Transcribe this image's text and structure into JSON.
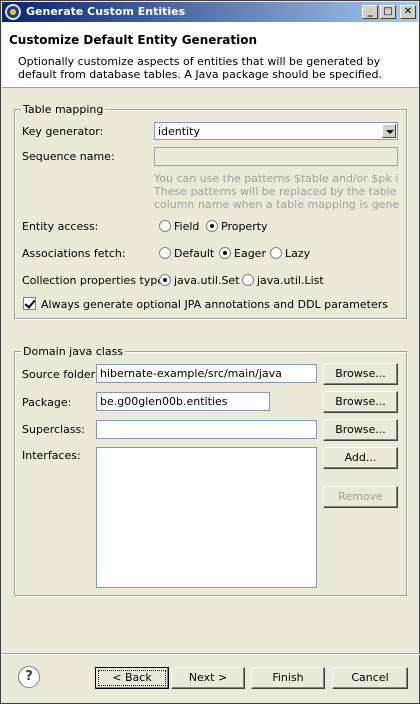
{
  "window": {
    "title": "Generate Custom Entities",
    "min_glyph": "_",
    "max_glyph": "□",
    "close_glyph": "✕"
  },
  "header": {
    "title": "Customize Default Entity Generation",
    "description": "Optionally customize aspects of entities that will be generated by default from database tables. A Java package should be specified."
  },
  "table_mapping": {
    "legend": "Table mapping",
    "key_generator": {
      "label": "Key generator:",
      "value": "identity"
    },
    "sequence_name": {
      "label": "Sequence name:",
      "value": ""
    },
    "hint": [
      "You can use the patterns $table and/or $pk in the s",
      "These patterns will be replaced by the table name a",
      "column name when a table mapping is generated."
    ],
    "entity_access": {
      "label": "Entity access:",
      "options": [
        "Field",
        "Property"
      ],
      "selected": "Property"
    },
    "associations_fetch": {
      "label": "Associations fetch:",
      "options": [
        "Default",
        "Eager",
        "Lazy"
      ],
      "selected": "Eager"
    },
    "collection_type": {
      "label": "Collection properties type:",
      "options": [
        "java.util.Set",
        "java.util.List"
      ],
      "selected": "java.util.Set"
    },
    "always_generate": {
      "label": "Always generate optional JPA annotations and DDL parameters",
      "checked": true
    }
  },
  "domain_class": {
    "legend": "Domain java class",
    "source_folder": {
      "label": "Source folder:",
      "value": "hibernate-example/src/main/java"
    },
    "package": {
      "label": "Package:",
      "value": "be.g00glen00b.entities"
    },
    "superclass": {
      "label": "Superclass:",
      "value": ""
    },
    "interfaces": {
      "label": "Interfaces:",
      "items": []
    },
    "browse_label": "Browse...",
    "add_label": "Add...",
    "remove_label": "Remove"
  },
  "footer": {
    "help_glyph": "?",
    "back_label": "< Back",
    "next_label": "Next >",
    "finish_label": "Finish",
    "cancel_label": "Cancel"
  }
}
